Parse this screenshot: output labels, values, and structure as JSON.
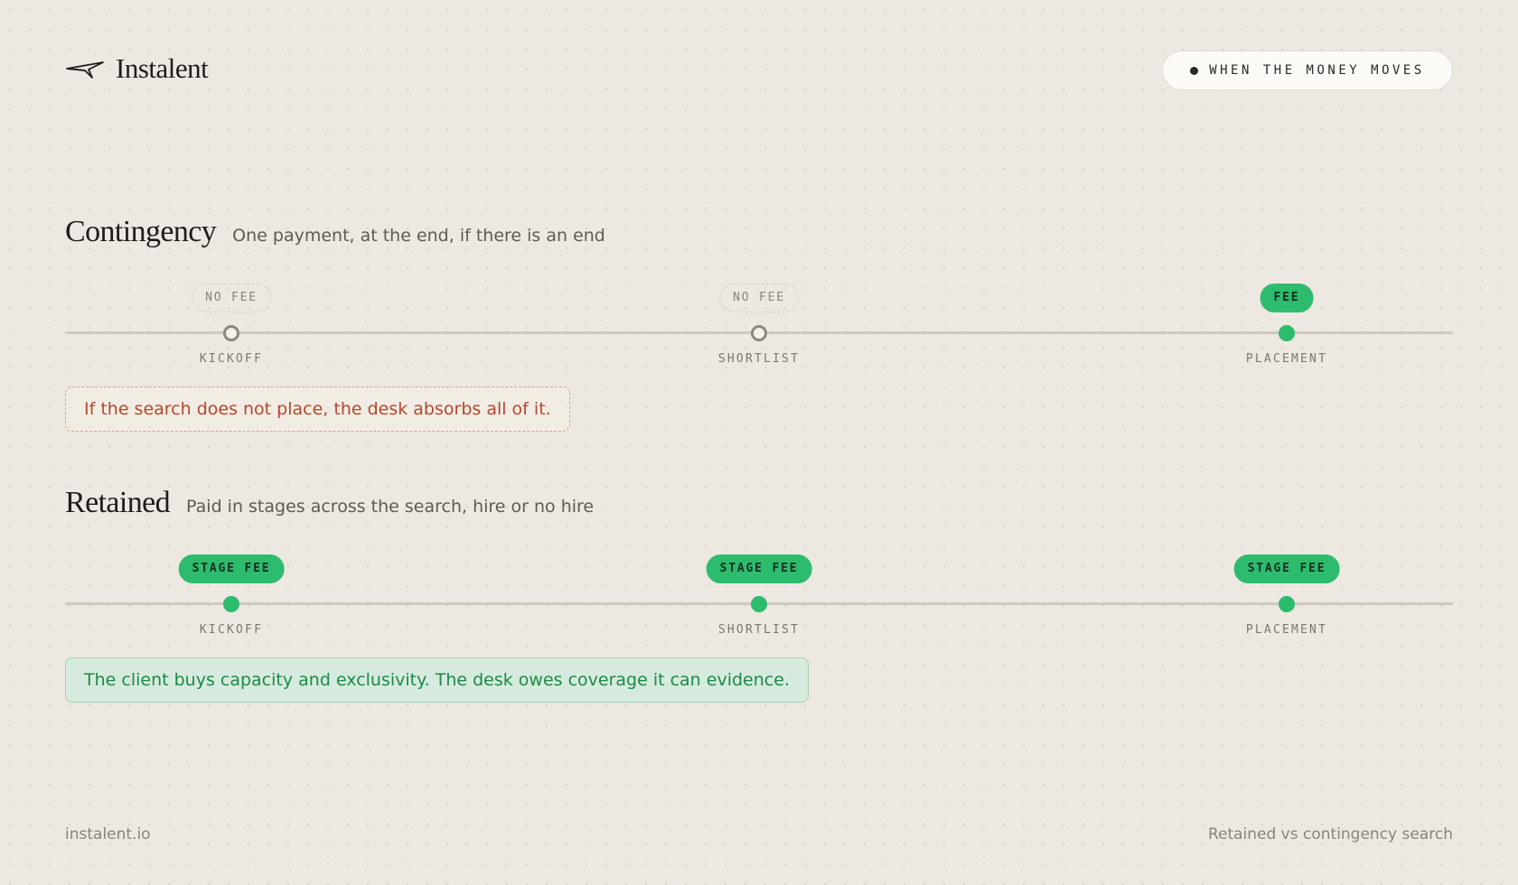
{
  "brand": {
    "name": "Instalent",
    "icon": "paper-plane-icon"
  },
  "header_pill": {
    "text": "WHEN THE MONEY MOVES",
    "icon": "dot-icon"
  },
  "contingency": {
    "title": "Contingency",
    "subtitle": "One payment, at the end, if there is an end",
    "stages": [
      {
        "label": "KICKOFF",
        "badge": "NO FEE",
        "paid": false
      },
      {
        "label": "SHORTLIST",
        "badge": "NO FEE",
        "paid": false
      },
      {
        "label": "PLACEMENT",
        "badge": "FEE",
        "paid": true
      }
    ],
    "note": "If the search does not place, the desk absorbs all of it."
  },
  "retained": {
    "title": "Retained",
    "subtitle": "Paid in stages across the search, hire or no hire",
    "stages": [
      {
        "label": "KICKOFF",
        "badge": "STAGE FEE",
        "paid": true
      },
      {
        "label": "SHORTLIST",
        "badge": "STAGE FEE",
        "paid": true
      },
      {
        "label": "PLACEMENT",
        "badge": "STAGE FEE",
        "paid": true
      }
    ],
    "note": "The client buys capacity and exclusivity. The desk owes coverage it can evidence."
  },
  "footer": {
    "left": "instalent.io",
    "right": "Retained vs contingency search"
  },
  "colors": {
    "background": "#ede8e1",
    "accent_green": "#2dbb6e",
    "warning_red": "#b6472c",
    "track_gray": "#cfc9c0"
  }
}
